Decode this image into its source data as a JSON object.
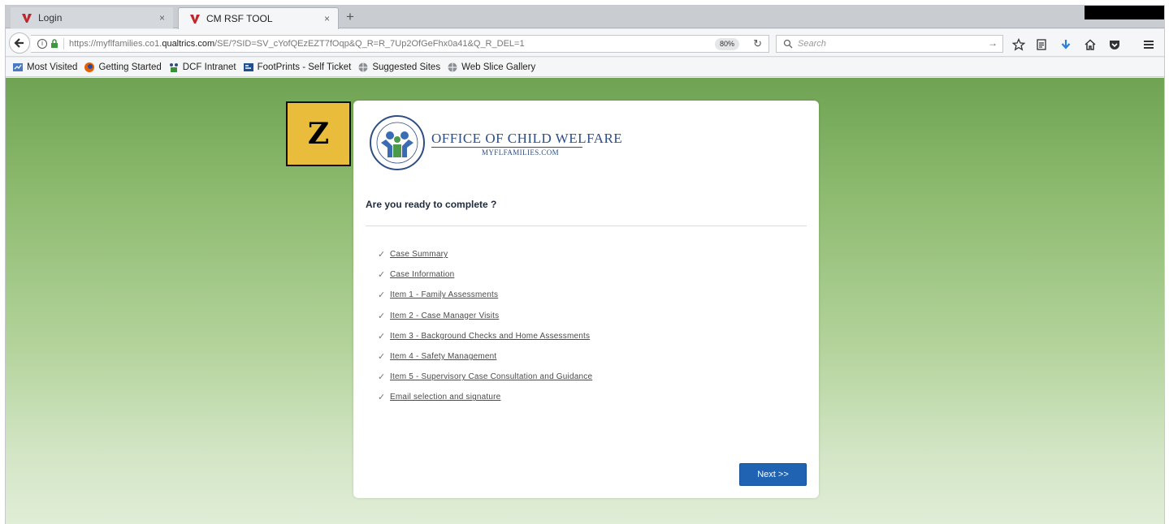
{
  "tabs": [
    {
      "title": "Login",
      "close": "×"
    },
    {
      "title": "CM RSF TOOL",
      "close": "×"
    }
  ],
  "new_tab": "+",
  "navbar": {
    "url_prefix": "https://myflfamilies.co1.",
    "url_domain": "qualtrics.com",
    "url_suffix": "/SE/?SID=SV_cYofQEzEZT7fOqp&Q_R=R_7Up2OfGeFhx0a41&Q_R_DEL=1",
    "zoom": "80%",
    "search_placeholder": "Search"
  },
  "bookmarks": [
    {
      "label": "Most Visited",
      "icon": "most-visited-icon"
    },
    {
      "label": "Getting Started",
      "icon": "firefox-icon"
    },
    {
      "label": "DCF Intranet",
      "icon": "dcf-icon"
    },
    {
      "label": "FootPrints - Self Ticket",
      "icon": "footprints-icon"
    },
    {
      "label": "Suggested Sites",
      "icon": "globe-icon"
    },
    {
      "label": "Web Slice Gallery",
      "icon": "globe-icon"
    }
  ],
  "badge": {
    "letter": "Z"
  },
  "logo": {
    "title": "OFFICE OF CHILD WELFARE",
    "subtitle": "MYFLFAMILIES.COM",
    "seal_text": "FLORIDA DEPARTMENT OF CHILDREN AND FAMILIES"
  },
  "survey": {
    "question": "Are you ready to complete ?",
    "sections": [
      "Case Summary",
      "Case Information",
      "Item 1 - Family Assessments",
      "Item 2 - Case Manager Visits",
      "Item 3 - Background Checks and Home Assessments",
      "Item 4 - Safety Management",
      "Item 5 - Supervisory Case Consultation and Guidance",
      "Email selection and signature"
    ],
    "check_glyph": "✓",
    "next_label": "Next >>"
  },
  "colors": {
    "page_gradient_top": "#6fa353",
    "page_gradient_bottom": "#e0edd7",
    "badge_fill": "#e9bc3c",
    "next_button": "#1f63b2",
    "logo_blue": "#2d4e85"
  }
}
